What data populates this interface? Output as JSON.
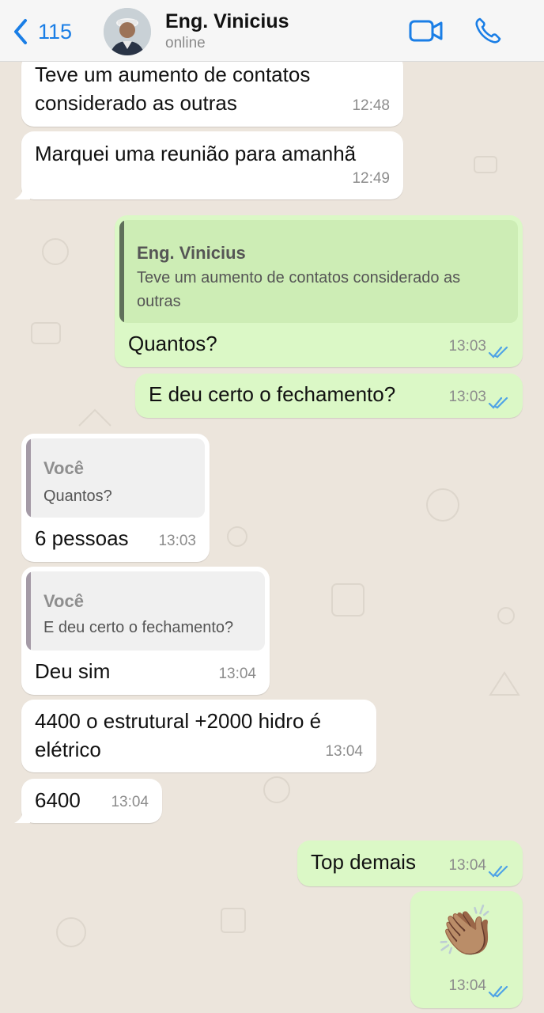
{
  "header": {
    "back_count": "115",
    "contact_name": "Eng. Vinicius",
    "contact_status": "online"
  },
  "colors": {
    "accent_blue": "#1a7ee6",
    "incoming_bubble": "#ffffff",
    "outgoing_bubble": "#dbf8c6",
    "read_ticks": "#4fa3e6",
    "chat_background": "#ece5dc"
  },
  "messages": [
    {
      "dir": "in",
      "text": "Teve um aumento de contatos\nconsiderado as outras",
      "time": "12:48"
    },
    {
      "dir": "in",
      "text": "Marquei uma reunião para amanhã",
      "time": "12:49"
    },
    {
      "dir": "out",
      "quote_name": "Eng. Vinicius",
      "quote_text": "Teve um aumento de contatos considerado as\noutras",
      "text": "Quantos?",
      "time": "13:03",
      "status": "read"
    },
    {
      "dir": "out",
      "text": "E deu certo o fechamento?",
      "time": "13:03",
      "status": "read"
    },
    {
      "dir": "in",
      "quote_name": "Você",
      "quote_text": "Quantos?",
      "text": "6 pessoas",
      "time": "13:03"
    },
    {
      "dir": "in",
      "quote_name": "Você",
      "quote_text": "E deu certo o fechamento?",
      "text": "Deu sim",
      "time": "13:04"
    },
    {
      "dir": "in",
      "text": "4400 o estrutural +2000 hidro é\nelétrico",
      "time": "13:04"
    },
    {
      "dir": "in",
      "text": "6400",
      "time": "13:04"
    },
    {
      "dir": "out",
      "text": "Top demais",
      "time": "13:04",
      "status": "read"
    },
    {
      "dir": "out",
      "emoji": "👏🏽",
      "emoji_name": "clapping-hands-icon",
      "time": "13:04",
      "status": "read"
    }
  ]
}
